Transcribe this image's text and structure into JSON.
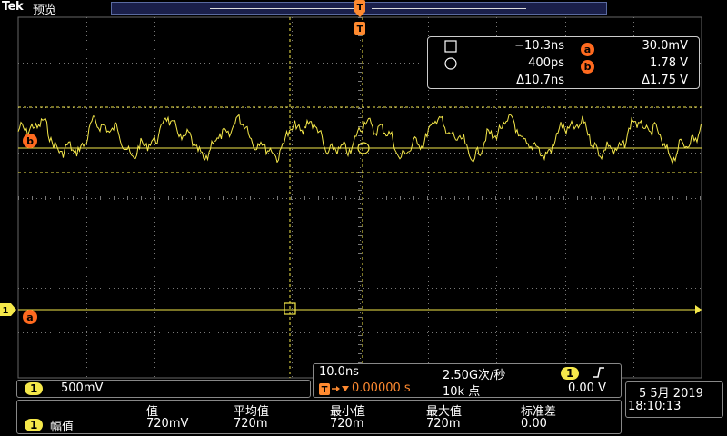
{
  "header": {
    "brand": "Tek",
    "title": "预览",
    "trigger_marker": "T"
  },
  "channel": {
    "number": "1",
    "label_a": "a",
    "label_b": "b"
  },
  "cursors": {
    "row1": {
      "time_label": "−10.3ns",
      "marker": "a",
      "volt_label": "30.0mV"
    },
    "row2": {
      "time_label": "400ps",
      "marker": "b",
      "volt_label": "1.78 V"
    },
    "row3": {
      "delta_time": "Δ10.7ns",
      "delta_volt": "Δ1.75 V"
    }
  },
  "vertical": {
    "channel": "1",
    "scale": "500mV"
  },
  "horizontal": {
    "scale": "10.0ns",
    "sample_rate": "2.50G次/秒",
    "trigger_position": "0.00000 s",
    "record_length": "10k 点",
    "trigger_channel": "1",
    "trigger_level": "0.00 V"
  },
  "date": {
    "date": "5 5月 2019",
    "time": "18:10:13"
  },
  "measurements": {
    "headers": [
      "值",
      "平均值",
      "最小值",
      "最大值",
      "标准差"
    ],
    "row": {
      "channel": "1",
      "name": "幅值",
      "values": [
        "720mV",
        "720m",
        "720m",
        "720m",
        "0.00"
      ]
    }
  },
  "colors": {
    "trace": "#f5e84a",
    "marker": "#ff6a1f",
    "grid": "#7a7a7a"
  },
  "icons": {
    "square": "square-cursor-icon",
    "circle": "circle-cursor-icon",
    "edge": "rising-edge-icon"
  }
}
